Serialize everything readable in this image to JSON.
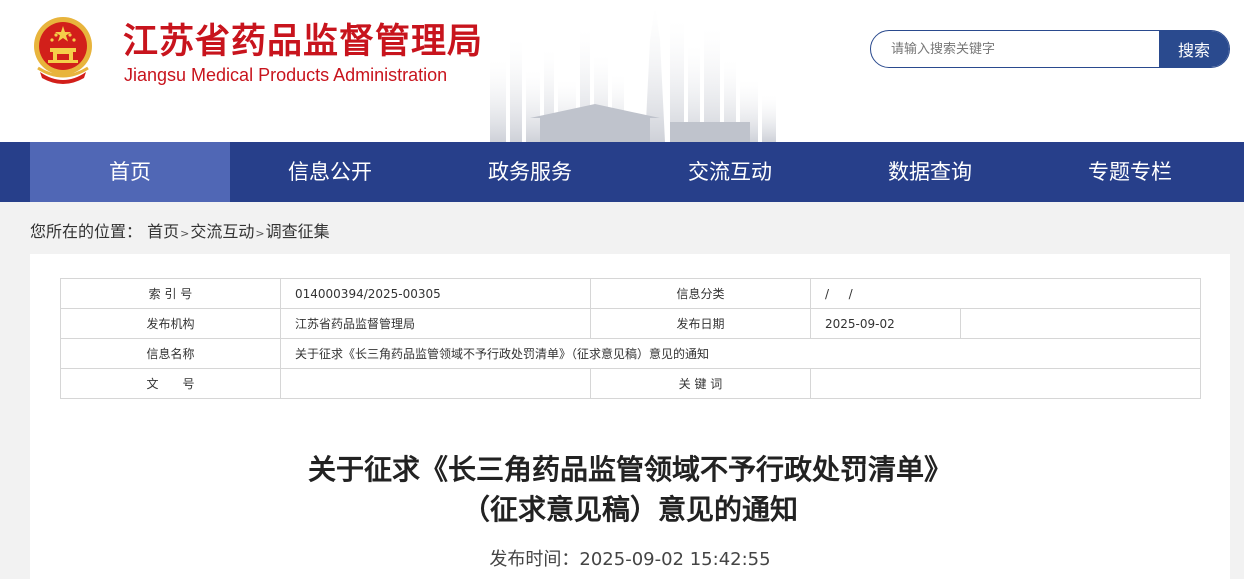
{
  "header": {
    "title": "江苏省药品监督管理局",
    "subtitle": "Jiangsu Medical Products Administration",
    "emblem_icon": "national-emblem-icon",
    "search_placeholder": "请输入搜索关键字",
    "search_button": "搜索"
  },
  "colors": {
    "brand_red": "#c8141d",
    "nav_blue": "#273f8a",
    "nav_active": "#5067b5"
  },
  "nav": {
    "items": [
      {
        "label": "首页",
        "active": true
      },
      {
        "label": "信息公开"
      },
      {
        "label": "政务服务"
      },
      {
        "label": "交流互动"
      },
      {
        "label": "数据查询"
      },
      {
        "label": "专题专栏"
      }
    ]
  },
  "breadcrumb": {
    "prefix": "您所在的位置：",
    "items": [
      "首页",
      "交流互动",
      "调查征集"
    ],
    "separator": ">"
  },
  "meta": {
    "index_label": "索 引 号",
    "index_value": "014000394/2025-00305",
    "category_label": "信息分类",
    "category_value": "/ 　 /",
    "publisher_label": "发布机构",
    "publisher_value": "江苏省药品监督管理局",
    "date_label": "发布日期",
    "date_value": "2025-09-02",
    "name_label": "信息名称",
    "name_value": "关于征求《长三角药品监管领域不予行政处罚清单》（征求意见稿）意见的通知",
    "docno_label": "文　　号",
    "docno_value": "",
    "keywords_label": "关 键 词",
    "keywords_value": ""
  },
  "article": {
    "title_line1": "关于征求《长三角药品监管领域不予行政处罚清单》",
    "title_line2": "（征求意见稿）意见的通知",
    "pub_time": "发布时间：2025-09-02 15:42:55"
  }
}
